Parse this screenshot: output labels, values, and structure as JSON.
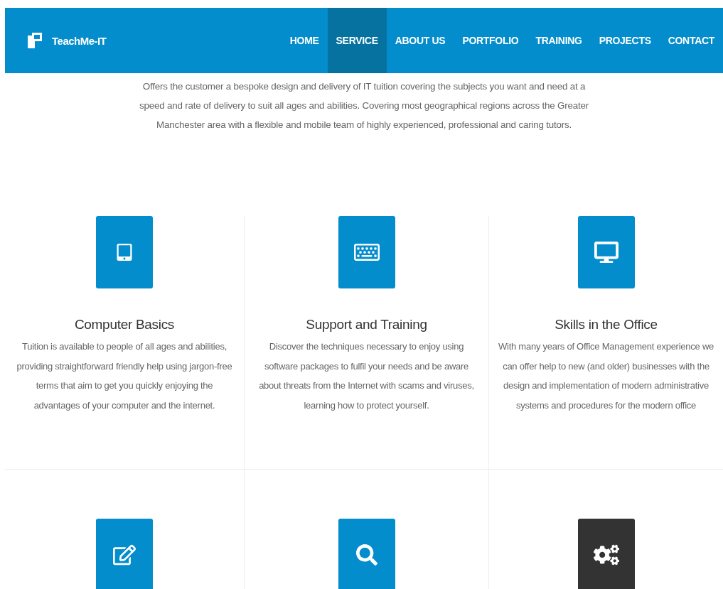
{
  "header": {
    "logo": "TeachMe-IT",
    "nav": [
      {
        "label": "HOME",
        "selected": false
      },
      {
        "label": "SERVICE",
        "selected": true
      },
      {
        "label": "ABOUT US",
        "selected": false
      },
      {
        "label": "PORTFOLIO",
        "selected": false
      },
      {
        "label": "TRAINING",
        "selected": false
      },
      {
        "label": "PROJECTS",
        "selected": false
      },
      {
        "label": "CONTACT",
        "selected": false
      }
    ]
  },
  "intro": "Offers the customer a bespoke design and delivery of IT tuition covering the subjects you want and need at a speed and rate of delivery to suit all ages and abilities. Covering most geographical regions across the Greater Manchester area with a flexible and mobile team of highly experienced, professional and caring tutors.",
  "services": [
    {
      "title": "Computer Basics",
      "text": "Tuition is available to people of all ages and abilities, providing straightforward friendly help using jargon-free terms that aim to get you quickly enjoying the advantages of your computer and the internet.",
      "highlighted": false
    },
    {
      "title": "Support and Training",
      "text": "Discover the techniques necessary to enjoy using software packages to fulfil your needs and be aware about threats from the Internet with scams and viruses, learning how to protect yourself.",
      "highlighted": false
    },
    {
      "title": "Skills in the Office",
      "text": "With many years of Office Management experience we can offer help to new (and older) businesses with the design and implementation of modern administrative systems and procedures for the modern office",
      "highlighted": false
    },
    {
      "highlighted": false
    },
    {
      "highlighted": false
    },
    {
      "highlighted": true
    }
  ]
}
